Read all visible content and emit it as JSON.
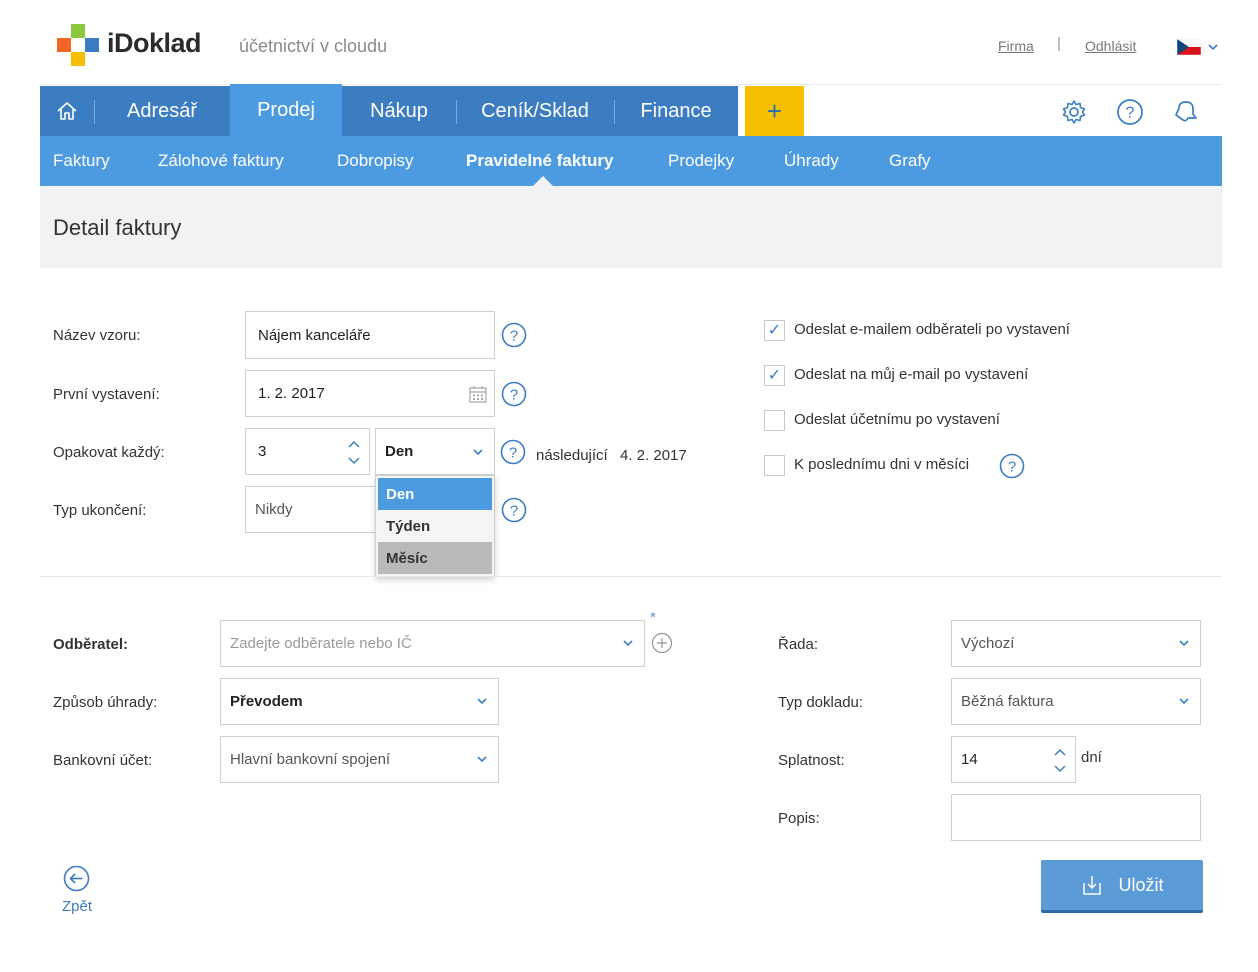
{
  "header": {
    "brand": "iDoklad",
    "tagline": "účetnictví v cloudu",
    "links": {
      "firma": "Firma",
      "separator": "|",
      "logout": "Odhlásit"
    },
    "flag_icon": "czech-flag-icon"
  },
  "main_nav": {
    "items": [
      {
        "label": "Adresář"
      },
      {
        "label": "Prodej",
        "active": true
      },
      {
        "label": "Nákup"
      },
      {
        "label": "Ceník/Sklad"
      },
      {
        "label": "Finance"
      }
    ],
    "plus_label": "+",
    "icons": [
      "settings-icon",
      "help-icon",
      "bell-icon"
    ]
  },
  "sub_nav": {
    "items": [
      {
        "label": "Faktury"
      },
      {
        "label": "Zálohové faktury"
      },
      {
        "label": "Dobropisy"
      },
      {
        "label": "Pravidelné faktury",
        "active": true
      },
      {
        "label": "Prodejky"
      },
      {
        "label": "Úhrady"
      },
      {
        "label": "Grafy"
      }
    ]
  },
  "page": {
    "title": "Detail faktury"
  },
  "template_form": {
    "name_label": "Název vzoru:",
    "name_value": "Nájem kanceláře",
    "first_issue_label": "První vystavení:",
    "first_issue_value": "1. 2. 2017",
    "repeat_label": "Opakovat každý:",
    "repeat_count": "3",
    "repeat_unit": "Den",
    "next_label": "následující",
    "next_date": "4. 2. 2017",
    "end_type_label": "Typ ukončení:",
    "end_type_value": "Nikdy",
    "unit_options": [
      "Den",
      "Týden",
      "Měsíc"
    ],
    "unit_selected": "Den",
    "unit_hovered": "Měsíc"
  },
  "options": [
    {
      "label": "Odeslat e-mailem odběrateli po vystavení",
      "checked": true
    },
    {
      "label": "Odeslat na můj e-mail po vystavení",
      "checked": true
    },
    {
      "label": "Odeslat účetnímu po vystavení",
      "checked": false
    },
    {
      "label": "K poslednímu dni v měsíci",
      "checked": false
    }
  ],
  "invoice_form": {
    "customer_label": "Odběratel:",
    "customer_placeholder": "Zadejte odběratele nebo IČ",
    "required_mark": "*",
    "payment_label": "Způsob úhrady:",
    "payment_value": "Převodem",
    "bank_label": "Bankovní účet:",
    "bank_value": "Hlavní bankovní spojení",
    "series_label": "Řada:",
    "series_value": "Výchozí",
    "doc_type_label": "Typ dokladu:",
    "doc_type_value": "Běžná faktura",
    "due_label": "Splatnost:",
    "due_value": "14",
    "due_unit": "dní",
    "desc_label": "Popis:",
    "desc_value": ""
  },
  "actions": {
    "save": "Uložit",
    "back": "Zpět"
  },
  "colors": {
    "nav_dark": "#3b7dc0",
    "nav_light": "#4c9be0",
    "accent_yellow": "#f6c000",
    "button": "#5a9bd8"
  }
}
